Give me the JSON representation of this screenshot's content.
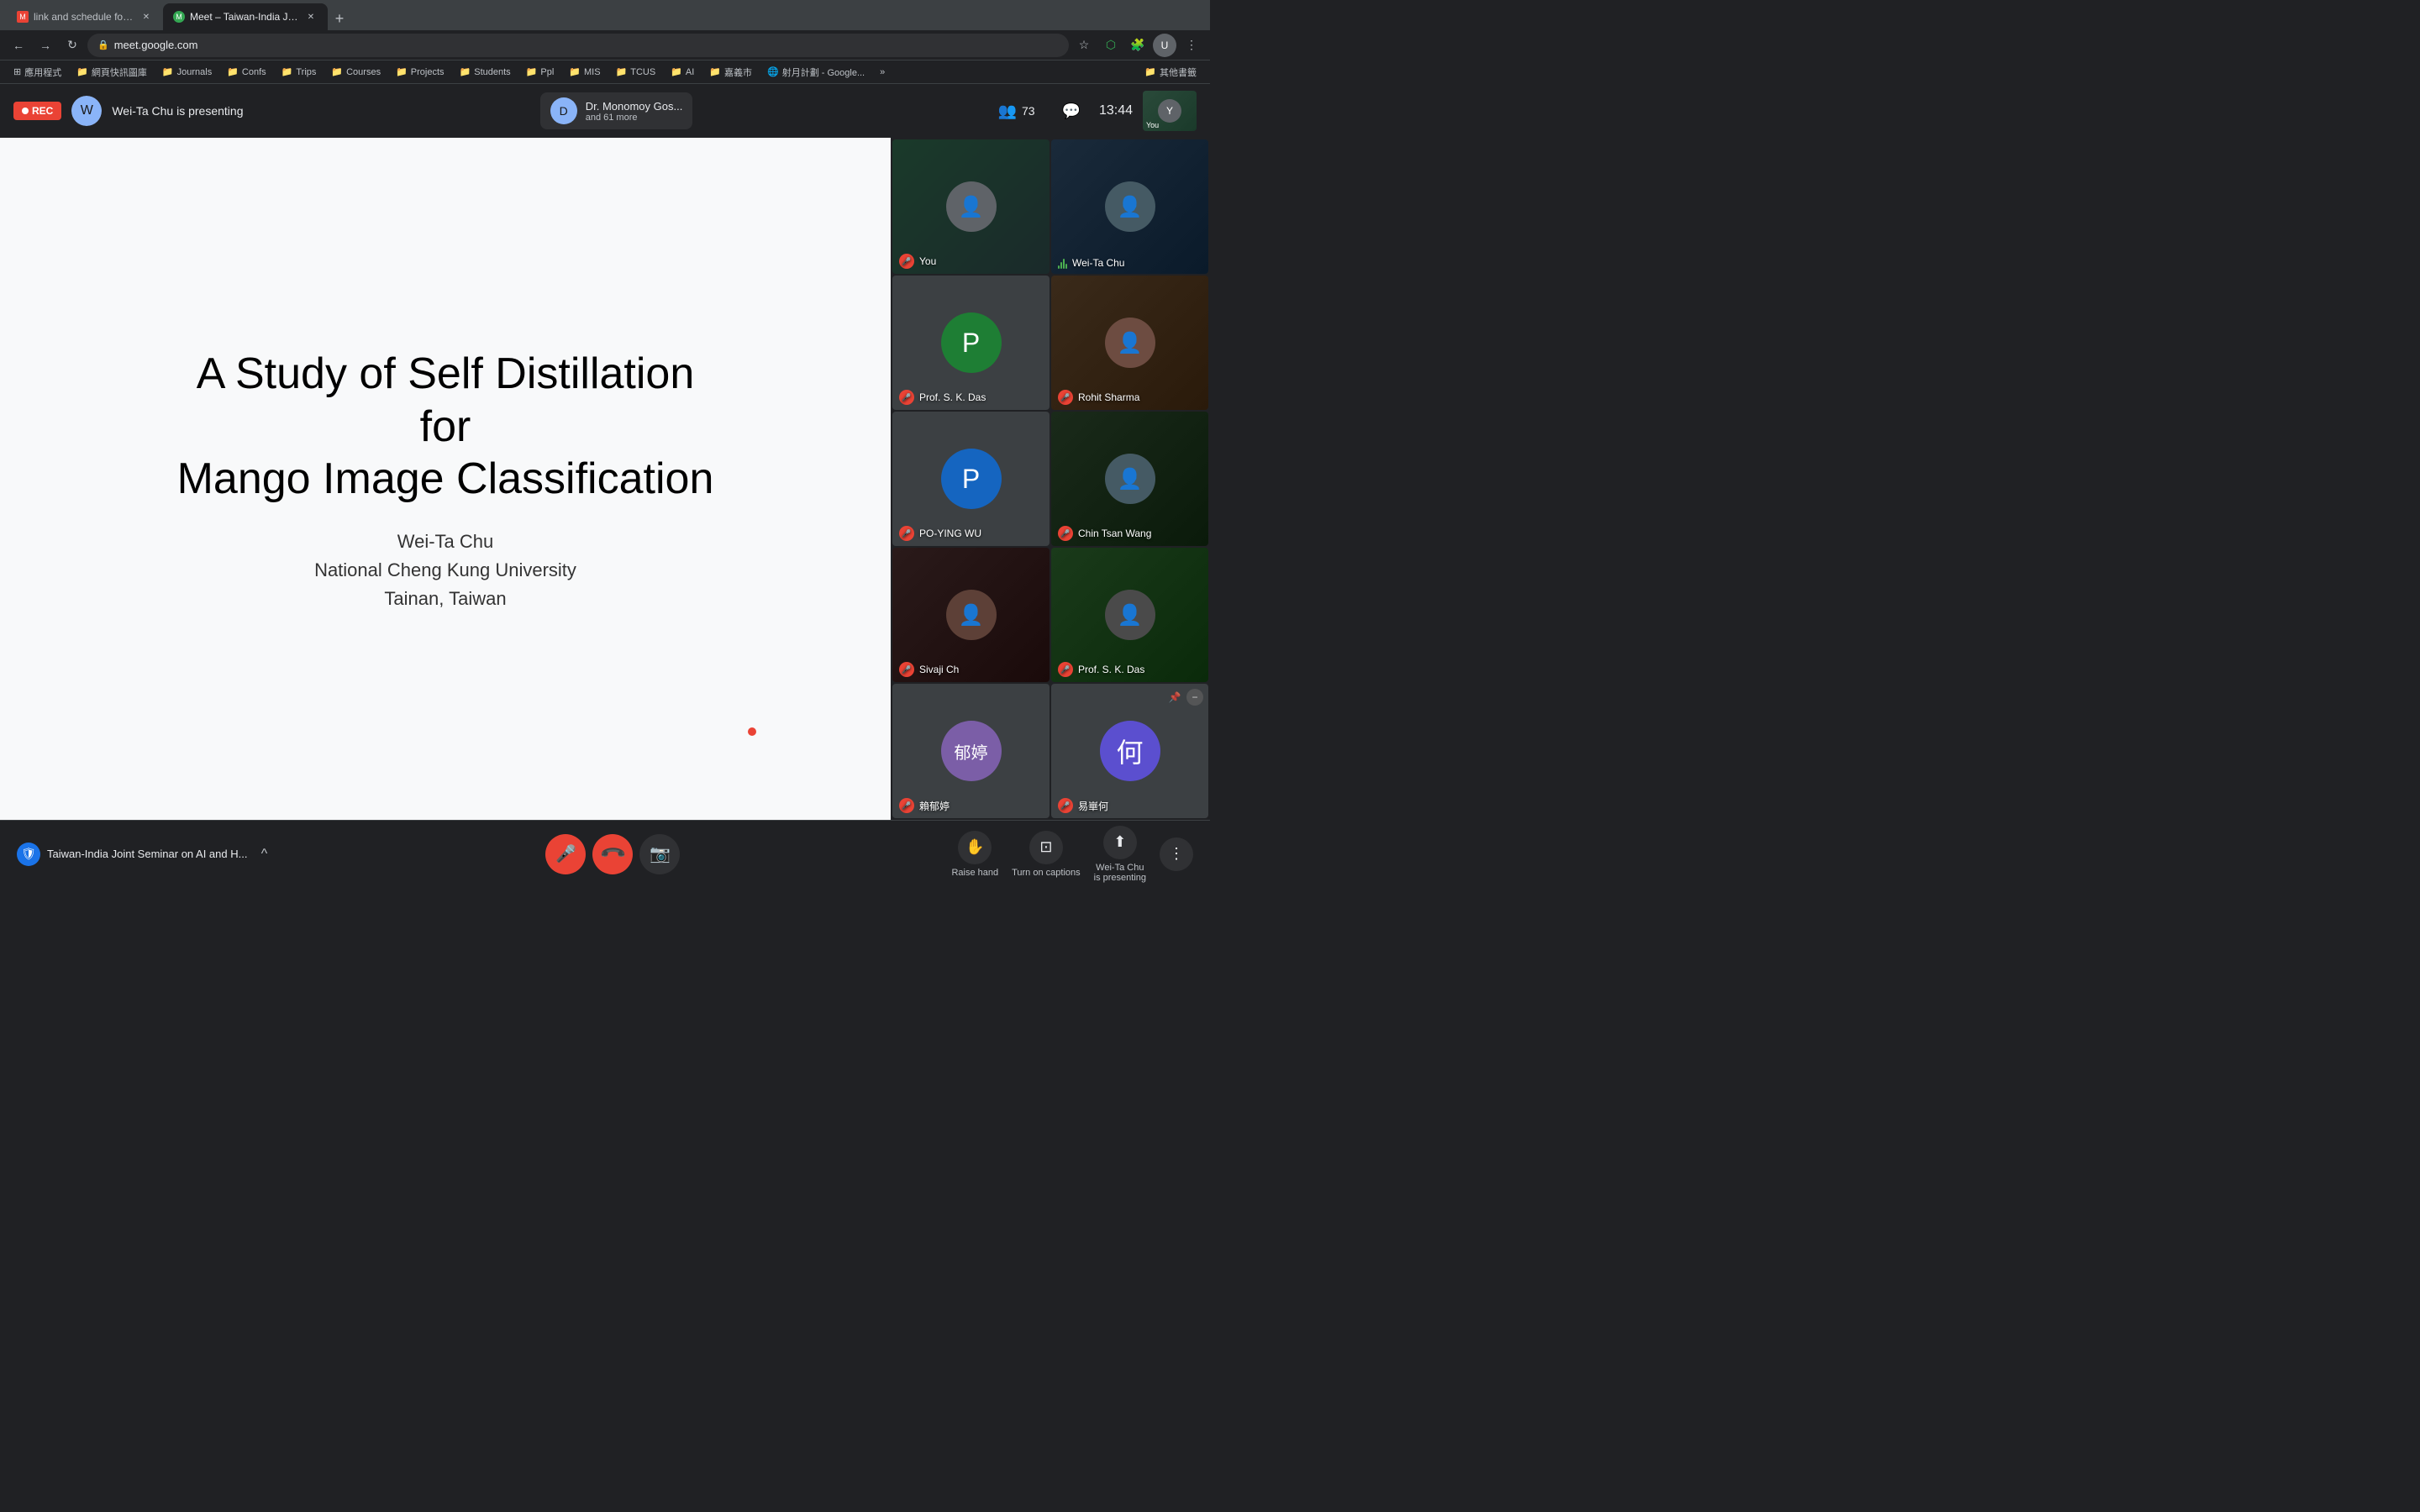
{
  "browser": {
    "tabs": [
      {
        "id": "tab-gmail",
        "label": "link and schedule for the Taiw...",
        "favicon_color": "#ea4335",
        "favicon_letter": "M",
        "active": false
      },
      {
        "id": "tab-meet",
        "label": "Meet – Taiwan-India Joint...",
        "favicon_color": "#34a853",
        "favicon_letter": "M",
        "active": true
      }
    ],
    "new_tab_icon": "+",
    "url": "meet.google.com",
    "nav": {
      "back": "←",
      "forward": "→",
      "refresh": "↻",
      "lock": "🔒"
    },
    "bookmarks": [
      {
        "label": "應用程式",
        "has_icon": true
      },
      {
        "label": "網頁快訊圖庫",
        "has_icon": true
      },
      {
        "label": "Journals",
        "has_icon": true
      },
      {
        "label": "Confs",
        "has_icon": true
      },
      {
        "label": "Trips",
        "has_icon": true
      },
      {
        "label": "Courses",
        "has_icon": true
      },
      {
        "label": "Projects",
        "has_icon": true
      },
      {
        "label": "Students",
        "has_icon": true
      },
      {
        "label": "Ppl",
        "has_icon": true
      },
      {
        "label": "MIS",
        "has_icon": true
      },
      {
        "label": "TCUS",
        "has_icon": true
      },
      {
        "label": "AI",
        "has_icon": true
      },
      {
        "label": "嘉義市",
        "has_icon": true
      },
      {
        "label": "射月計劃 - Google...",
        "has_icon": true
      },
      {
        "label": "»",
        "has_icon": false
      },
      {
        "label": "其他書籤",
        "has_icon": true
      }
    ]
  },
  "meet": {
    "rec_label": "REC",
    "presenter_name": "Wei-Ta Chu is presenting",
    "speaker": {
      "name": "Dr. Monomoy Gos...",
      "subtitle": "and 61 more"
    },
    "participants_count": "73",
    "timer": "13:44",
    "you_label": "You",
    "slide": {
      "title": "A Study of Self Distillation\nfor\nMango Image Classification",
      "author": "Wei-Ta Chu",
      "institution": "National Cheng Kung University",
      "location": "Tainan, Taiwan"
    },
    "participants": [
      {
        "id": "you",
        "name": "You",
        "type": "video",
        "muted": true,
        "audio_active": false,
        "tile_bg": "tile-bg-you"
      },
      {
        "id": "wei-ta-chu",
        "name": "Wei-Ta Chu",
        "type": "video",
        "muted": false,
        "audio_active": true,
        "tile_bg": "tile-bg-2"
      },
      {
        "id": "prof-sk-das",
        "name": "Prof. S. K. Das",
        "type": "avatar",
        "avatar_letter": "P",
        "avatar_color": "#1e7e34",
        "muted": true,
        "audio_active": false
      },
      {
        "id": "rohit-sharma",
        "name": "Rohit Sharma",
        "type": "video",
        "muted": true,
        "audio_active": false,
        "tile_bg": "tile-bg-3"
      },
      {
        "id": "po-ying-wu",
        "name": "PO-YING WU",
        "type": "avatar",
        "avatar_letter": "P",
        "avatar_color": "#1565c0",
        "muted": true,
        "audio_active": false
      },
      {
        "id": "chin-tsan-wang",
        "name": "Chin Tsan Wang",
        "type": "video",
        "muted": true,
        "audio_active": false,
        "tile_bg": "tile-bg-1"
      },
      {
        "id": "sivaji-ch",
        "name": "Sivaji Ch",
        "type": "video",
        "muted": true,
        "audio_active": false,
        "tile_bg": "tile-bg-3"
      },
      {
        "id": "prof-sk-das-2",
        "name": "Prof. S. K. Das",
        "type": "video",
        "muted": true,
        "audio_active": false,
        "tile_bg": "tile-bg-1"
      },
      {
        "id": "lai-yu-ting",
        "name": "賴郁婷",
        "type": "avatar",
        "avatar_letter": "郁婷",
        "avatar_color": "#7b5ea7",
        "muted": true,
        "audio_active": false
      },
      {
        "id": "yi-zhun-he",
        "name": "易崋何",
        "type": "avatar",
        "avatar_letter": "何",
        "avatar_color": "#5b4fcf",
        "muted": true,
        "audio_active": false,
        "has_pin": true,
        "has_minus": true
      }
    ],
    "bottom": {
      "meeting_title": "Taiwan-India Joint Seminar on AI and H...",
      "expand_icon": "^",
      "mic_off_icon": "🎤",
      "end_call_icon": "📞",
      "camera_icon": "📷",
      "raise_hand_label": "Raise hand",
      "captions_label": "Turn on captions",
      "presenting_label": "Wei-Ta Chu\nis presenting",
      "more_options_icon": "⋮"
    }
  }
}
